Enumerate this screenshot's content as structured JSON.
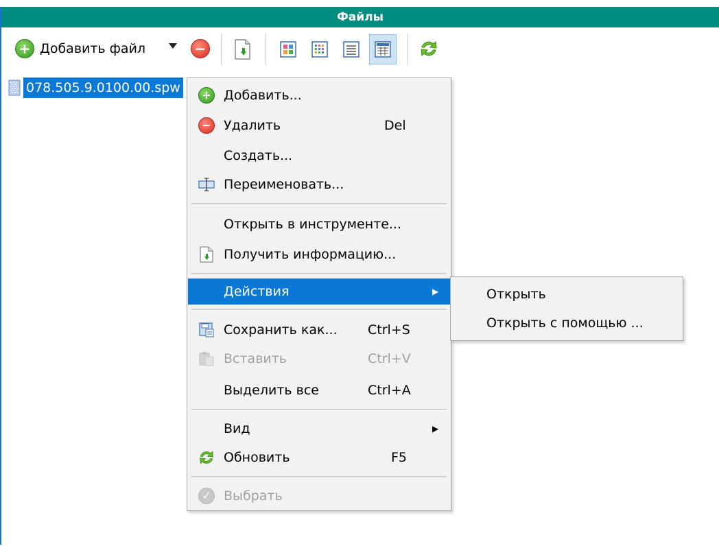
{
  "window": {
    "title": "Файлы"
  },
  "toolbar": {
    "add_file_label": "Добавить файл",
    "icons": [
      "add-icon",
      "dropdown-arrow-icon",
      "remove-icon",
      "get-info-icon",
      "view-icons-icon",
      "view-small-icons-icon",
      "view-list-icon",
      "view-details-icon",
      "refresh-icon"
    ],
    "active_view": "details"
  },
  "file_list": {
    "items": [
      {
        "name": "078.505.9.0100.00.spw",
        "selected": true
      }
    ]
  },
  "context_menu": {
    "items": [
      {
        "label": "Добавить...",
        "shortcut": "",
        "icon": "add-icon"
      },
      {
        "label": "Удалить",
        "shortcut": "Del",
        "icon": "remove-icon"
      },
      {
        "label": "Создать...",
        "shortcut": "",
        "icon": ""
      },
      {
        "label": "Переименовать...",
        "shortcut": "",
        "icon": "rename-icon"
      },
      {
        "label": "Открыть в инструменте...",
        "shortcut": "",
        "icon": ""
      },
      {
        "label": "Получить информацию...",
        "shortcut": "",
        "icon": "get-info-icon"
      },
      {
        "label": "Действия",
        "shortcut": "",
        "icon": "",
        "submenu": true,
        "highlighted": true
      },
      {
        "label": "Сохранить как...",
        "shortcut": "Ctrl+S",
        "icon": "save-as-icon"
      },
      {
        "label": "Вставить",
        "shortcut": "Ctrl+V",
        "icon": "paste-icon",
        "disabled": true
      },
      {
        "label": "Выделить все",
        "shortcut": "Ctrl+A",
        "icon": ""
      },
      {
        "label": "Вид",
        "shortcut": "",
        "icon": "",
        "submenu": true
      },
      {
        "label": "Обновить",
        "shortcut": "F5",
        "icon": "refresh-icon"
      },
      {
        "label": "Выбрать",
        "shortcut": "",
        "icon": "select-icon",
        "disabled": true
      }
    ]
  },
  "actions_submenu": {
    "items": [
      {
        "label": "Открыть"
      },
      {
        "label": "Открыть с помощью ..."
      }
    ]
  },
  "colors": {
    "title_bar": "#008c7e",
    "selection": "#0a78d7",
    "menu_background": "#f2f2f2"
  }
}
